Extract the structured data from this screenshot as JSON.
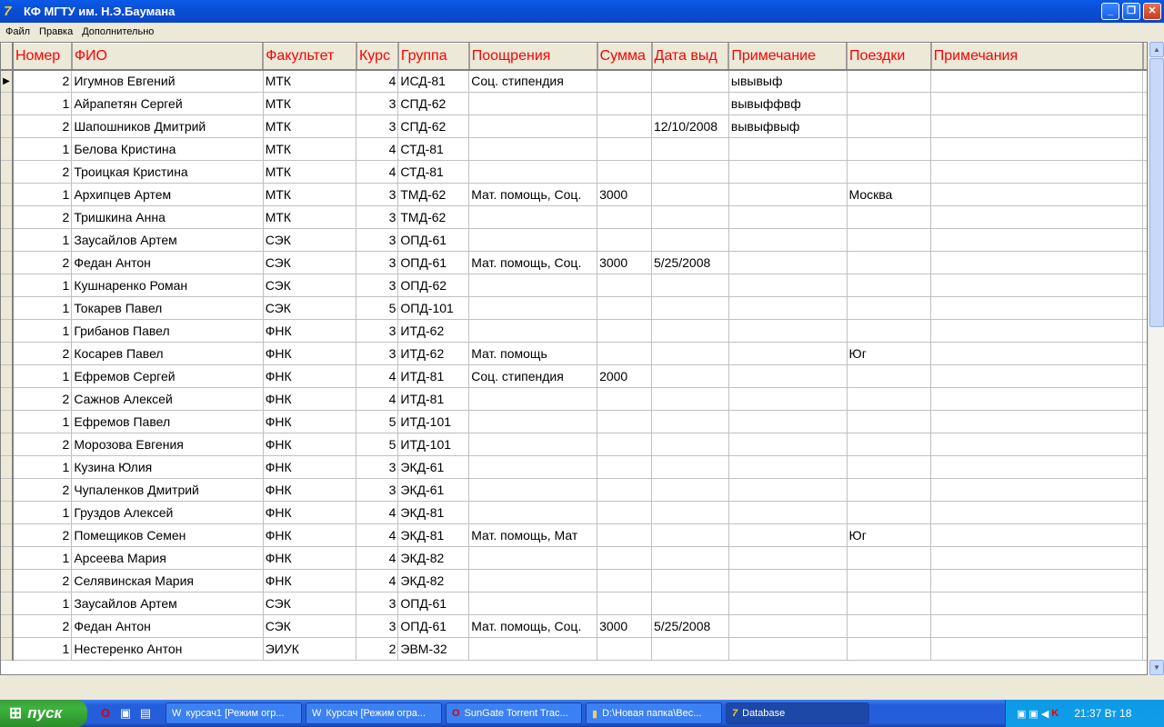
{
  "window": {
    "title": "КФ МГТУ им. Н.Э.Баумана",
    "icon": "delphi-icon"
  },
  "menu": [
    "Файл",
    "Правка",
    "Дополнительно"
  ],
  "columns": [
    "Номер",
    "ФИО",
    "Факультет",
    "Курс",
    "Группа",
    "Поощрения",
    "Сумма",
    "Дата выд",
    "Примечание",
    "Поездки",
    "Примечания"
  ],
  "rows": [
    [
      "2",
      "Игумнов Евгений",
      "МТК",
      "4",
      "ИСД-81",
      "Соц. стипендия",
      "",
      "",
      "ывывыф",
      "",
      ""
    ],
    [
      "1",
      "Айрапетян Сергей",
      "МТК",
      "3",
      "СПД-62",
      "",
      "",
      "",
      "вывыффвф",
      "",
      ""
    ],
    [
      "2",
      "Шапошников Дмитрий",
      "МТК",
      "3",
      "СПД-62",
      "",
      "",
      "12/10/2008",
      "вывыфвыф",
      "",
      ""
    ],
    [
      "1",
      "Белова Кристина",
      "МТК",
      "4",
      "СТД-81",
      "",
      "",
      "",
      "",
      "",
      ""
    ],
    [
      "2",
      "Троицкая Кристина",
      "МТК",
      "4",
      "СТД-81",
      "",
      "",
      "",
      "",
      "",
      ""
    ],
    [
      "1",
      "Архипцев Артем",
      "МТК",
      "3",
      "ТМД-62",
      "Мат. помощь, Соц.",
      "3000",
      "",
      "",
      "Москва",
      ""
    ],
    [
      "2",
      "Тришкина Анна",
      "МТК",
      "3",
      "ТМД-62",
      "",
      "",
      "",
      "",
      "",
      ""
    ],
    [
      "1",
      "Заусайлов Артем",
      "СЭК",
      "3",
      "ОПД-61",
      "",
      "",
      "",
      "",
      "",
      ""
    ],
    [
      "2",
      "Федан Антон",
      "СЭК",
      "3",
      "ОПД-61",
      "Мат. помощь, Соц.",
      "3000",
      "5/25/2008",
      "",
      "",
      ""
    ],
    [
      "1",
      "Кушнаренко Роман",
      "СЭК",
      "3",
      "ОПД-62",
      "",
      "",
      "",
      "",
      "",
      ""
    ],
    [
      "1",
      "Токарев Павел",
      "СЭК",
      "5",
      "ОПД-101",
      "",
      "",
      "",
      "",
      "",
      ""
    ],
    [
      "1",
      "Грибанов Павел",
      "ФНК",
      "3",
      "ИТД-62",
      "",
      "",
      "",
      "",
      "",
      ""
    ],
    [
      "2",
      "Косарев Павел",
      "ФНК",
      "3",
      "ИТД-62",
      "Мат. помощь",
      "",
      "",
      "",
      "Юг",
      ""
    ],
    [
      "1",
      "Ефремов Сергей",
      "ФНК",
      "4",
      "ИТД-81",
      "Соц. стипендия",
      "2000",
      "",
      "",
      "",
      ""
    ],
    [
      "2",
      "Сажнов Алексей",
      "ФНК",
      "4",
      "ИТД-81",
      "",
      "",
      "",
      "",
      "",
      ""
    ],
    [
      "1",
      "Ефремов Павел",
      "ФНК",
      "5",
      "ИТД-101",
      "",
      "",
      "",
      "",
      "",
      ""
    ],
    [
      "2",
      "Морозова Евгения",
      "ФНК",
      "5",
      "ИТД-101",
      "",
      "",
      "",
      "",
      "",
      ""
    ],
    [
      "1",
      "Кузина Юлия",
      "ФНК",
      "3",
      "ЭКД-61",
      "",
      "",
      "",
      "",
      "",
      ""
    ],
    [
      "2",
      "Чупаленков Дмитрий",
      "ФНК",
      "3",
      "ЭКД-61",
      "",
      "",
      "",
      "",
      "",
      ""
    ],
    [
      "1",
      "Груздов Алексей",
      "ФНК",
      "4",
      "ЭКД-81",
      "",
      "",
      "",
      "",
      "",
      ""
    ],
    [
      "2",
      "Помещиков Семен",
      "ФНК",
      "4",
      "ЭКД-81",
      "Мат. помощь, Мат",
      "",
      "",
      "",
      "Юг",
      ""
    ],
    [
      "1",
      "Арсеева Мария",
      "ФНК",
      "4",
      "ЭКД-82",
      "",
      "",
      "",
      "",
      "",
      ""
    ],
    [
      "2",
      "Селявинская Мария",
      "ФНК",
      "4",
      "ЭКД-82",
      "",
      "",
      "",
      "",
      "",
      ""
    ],
    [
      "1",
      "Заусайлов Артем",
      "СЭК",
      "3",
      "ОПД-61",
      "",
      "",
      "",
      "",
      "",
      ""
    ],
    [
      "2",
      "Федан Антон",
      "СЭК",
      "3",
      "ОПД-61",
      "Мат. помощь, Соц.",
      "3000",
      "5/25/2008",
      "",
      "",
      ""
    ],
    [
      "1",
      "Нестеренко Антон",
      "ЭИУК",
      "2",
      "ЭВМ-32",
      "",
      "",
      "",
      "",
      "",
      ""
    ]
  ],
  "taskbar": {
    "start": "пуск",
    "tasks": [
      "курсач1 [Режим огр...",
      "Курсач [Режим огра...",
      "SunGate Torrent Trac...",
      "D:\\Новая папка\\Вес...",
      "Database"
    ],
    "clock": "21:37 Вт 18"
  }
}
